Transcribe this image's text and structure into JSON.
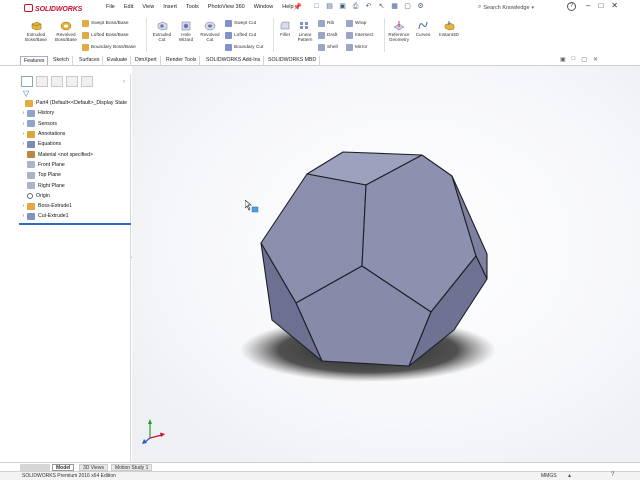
{
  "app": {
    "logo_text": "SOLIDWORKS",
    "menu": [
      "File",
      "Edit",
      "View",
      "Insert",
      "Tools",
      "PhotoView 360",
      "Window",
      "Help"
    ],
    "quick_tools": [
      "new-icon",
      "open-icon",
      "save-icon",
      "print-icon",
      "undo-icon",
      "select-icon",
      "rebuild-icon",
      "file-properties-icon",
      "options-icon"
    ],
    "search_placeholder": "Search Knowledge",
    "window_controls": [
      "minimize",
      "restore",
      "close"
    ]
  },
  "command_manager": {
    "large": [
      {
        "label": "Extruded Boss/Base",
        "l1": "Extruded",
        "l2": "Boss/Base",
        "icon": "extruded-boss-icon"
      },
      {
        "label": "Revolved Boss/Base",
        "l1": "Revolved",
        "l2": "Boss/Base",
        "icon": "revolved-boss-icon"
      },
      {
        "label": "Extruded Cut",
        "l1": "Extruded",
        "l2": "Cut",
        "icon": "extruded-cut-icon"
      },
      {
        "label": "Hole Wizard",
        "l1": "Hole",
        "l2": "Wizard",
        "icon": "hole-wizard-icon"
      },
      {
        "label": "Revolved Cut",
        "l1": "Revolved",
        "l2": "Cut",
        "icon": "revolved-cut-icon"
      },
      {
        "label": "Fillet",
        "l1": "Fillet",
        "l2": "",
        "icon": "fillet-icon"
      },
      {
        "label": "Linear Pattern",
        "l1": "Linear",
        "l2": "Pattern",
        "icon": "linear-pattern-icon"
      },
      {
        "label": "Reference Geometry",
        "l1": "Reference",
        "l2": "Geometry",
        "icon": "reference-geometry-icon"
      },
      {
        "label": "Curves",
        "l1": "Curves",
        "l2": "",
        "icon": "curves-icon"
      },
      {
        "label": "Instant3D",
        "l1": "Instant3D",
        "l2": "",
        "icon": "instant3d-icon"
      }
    ],
    "small": {
      "swept_boss": "Swept Boss/Base",
      "lofted_boss": "Lofted Boss/Base",
      "boundary_boss": "Boundary Boss/Base",
      "swept_cut": "Swept Cut",
      "lofted_cut": "Lofted Cut",
      "boundary_cut": "Boundary Cut",
      "rib": "Rib",
      "draft": "Draft",
      "shell": "Shell",
      "wrap": "Wrap",
      "intersect": "Intersect",
      "mirror": "Mirror"
    }
  },
  "tabs": [
    "Features",
    "Sketch",
    "Surfaces",
    "Evaluate",
    "DimXpert",
    "Render Tools",
    "SOLIDWORKS Add-Ins",
    "SOLIDWORKS MBD"
  ],
  "active_tab": "Features",
  "feature_tree": {
    "root": "Part4  (Default<<Default>_Display State",
    "items": [
      {
        "label": "History",
        "expandable": true
      },
      {
        "label": "Sensors",
        "expandable": true
      },
      {
        "label": "Annotations",
        "expandable": true
      },
      {
        "label": "Equations",
        "expandable": true
      },
      {
        "label": "Material <not specified>",
        "expandable": false
      },
      {
        "label": "Front Plane",
        "expandable": false
      },
      {
        "label": "Top Plane",
        "expandable": false
      },
      {
        "label": "Right Plane",
        "expandable": false
      },
      {
        "label": "Origin",
        "expandable": false
      },
      {
        "label": "Boss-Extrude1",
        "expandable": true
      },
      {
        "label": "Cut-Extrude1",
        "expandable": true
      }
    ]
  },
  "model_view": {
    "shape": "dodecahedron",
    "face_color": "#8c90ae",
    "shadow_color": "#2a2a2a"
  },
  "bottom_tabs": [
    "Model",
    "3D Views",
    "Motion Study 1"
  ],
  "active_bottom_tab": "Model",
  "status": {
    "left": "SOLIDWORKS Premium 2016 x64 Edition",
    "units": "MMGS"
  },
  "colors": {
    "brand_red": "#c8102e",
    "accent_blue": "#2a6cc9"
  }
}
